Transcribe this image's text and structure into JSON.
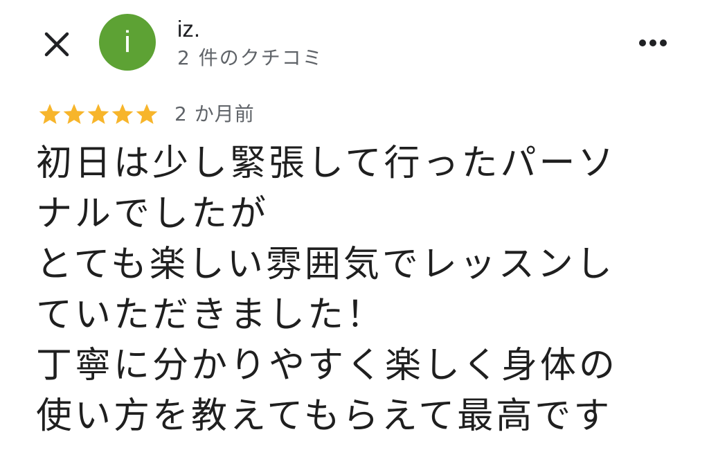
{
  "header": {
    "close_icon": "close-icon",
    "avatar": {
      "initial": "i",
      "color": "#5da234"
    },
    "user_name": "iz.",
    "review_count": "2 件のクチコミ",
    "more_icon": "more-horizontal-icon"
  },
  "review": {
    "rating": 5,
    "rating_max": 5,
    "star_color": "#f7b52b",
    "date": "2 か月前",
    "text_lines": [
      "初日は少し緊張して行ったパーソ",
      "ナルでしたが",
      "とても楽しい雰囲気でレッスンし",
      "ていただきました！",
      "丁寧に分かりやすく楽しく身体の",
      "使い方を教えてもらえて最高です"
    ]
  }
}
